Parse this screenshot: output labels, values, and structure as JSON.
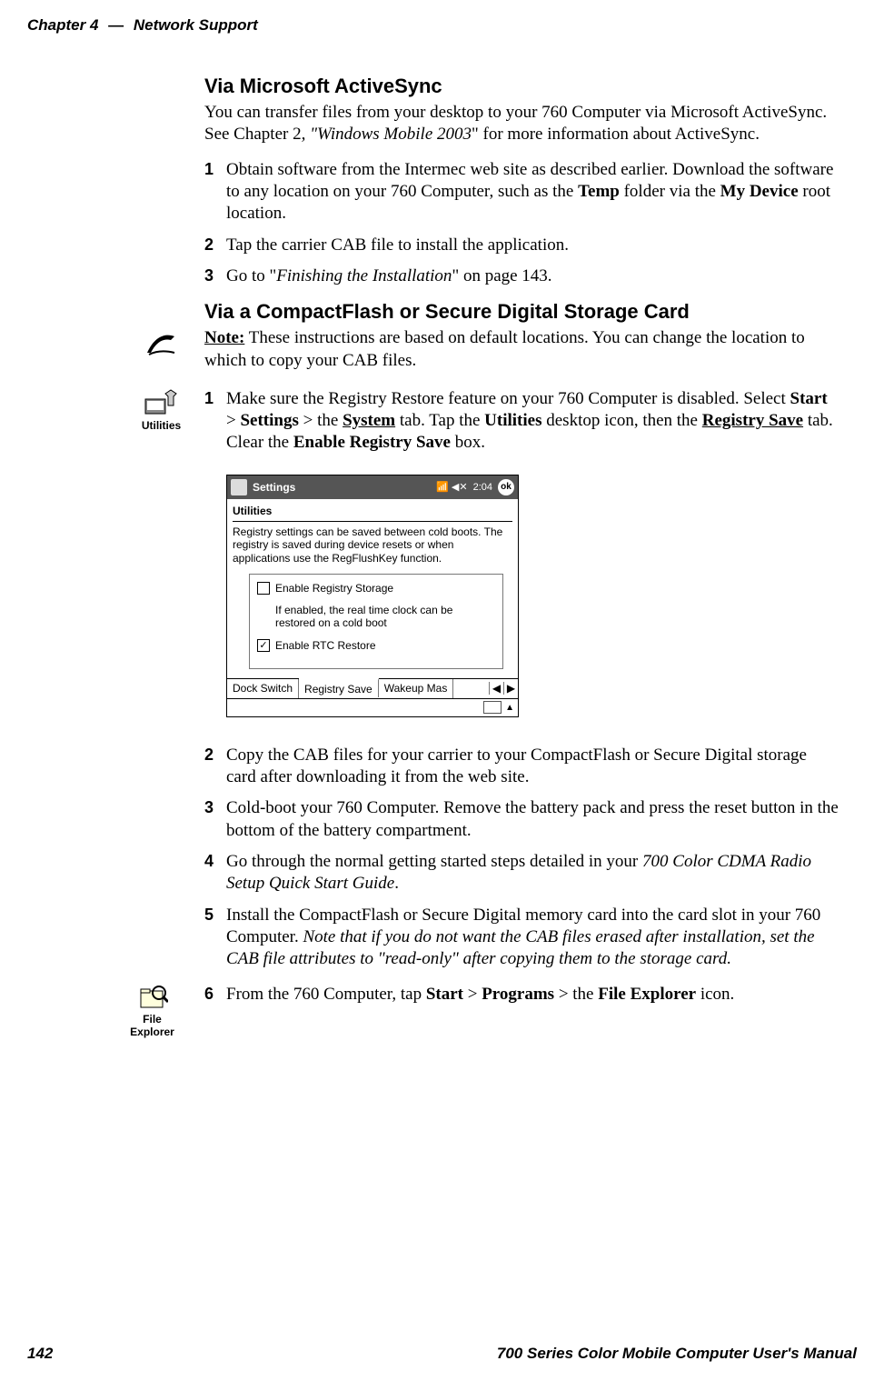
{
  "header": {
    "chapter": "Chapter 4",
    "dash": "—",
    "title": "Network Support"
  },
  "s1": {
    "heading": "Via Microsoft ActiveSync",
    "para_a": "You can transfer files from your desktop to your 760 Computer via Microsoft ActiveSync. See Chapter 2",
    "para_b": ", \"Windows Mobile 2003",
    "para_c": "\" for more information about ActiveSync.",
    "li1_a": "Obtain software from the Intermec web site as described earlier. Download the software to any location on your 760 Computer, such as the ",
    "li1_b": "Temp",
    "li1_c": " folder via the ",
    "li1_d": "My Device",
    "li1_e": " root location.",
    "li2": "Tap the carrier CAB file to install the application.",
    "li3_a": "Go to \"",
    "li3_b": "Finishing the Installation",
    "li3_c": "\" on page 143."
  },
  "s2": {
    "heading": "Via a CompactFlash or Secure Digital Storage Card",
    "note_label": "Note:",
    "note_text": " These instructions are based on default locations. You can change the location to which to copy your CAB files.",
    "util_caption": "Utilities",
    "li1_a": "Make sure the Registry Restore feature on your 760 Computer is disabled. Select ",
    "li1_b": "Start",
    "li1_c": " > ",
    "li1_d": "Settings",
    "li1_e": " > the ",
    "li1_f": "System",
    "li1_g": " tab. Tap the ",
    "li1_h": "Utilities",
    "li1_i": " desktop icon, then the ",
    "li1_j": "Registry Save",
    "li1_k": " tab. Clear the ",
    "li1_l": "Enable Registry Save",
    "li1_m": " box."
  },
  "pda": {
    "titlebar": "Settings",
    "time": "2:04",
    "ok": "ok",
    "apptitle": "Utilities",
    "desc": "Registry settings can be saved between cold boots. The registry is saved during device resets or when applications use the RegFlushKey function.",
    "chk1": "Enable Registry Storage",
    "sub": "If enabled, the real time clock can be restored on a cold boot",
    "chk2": "Enable RTC Restore",
    "tab1": "Dock Switch",
    "tab2": "Registry Save",
    "tab3": "Wakeup Mas"
  },
  "s3": {
    "li2": "Copy the CAB files for your carrier to your CompactFlash or Secure Digital storage card after downloading it from the web site.",
    "li3": "Cold-boot your 760 Computer. Remove the battery pack and press the reset button in the bottom of the battery compartment.",
    "li4_a": "Go through the normal getting started steps detailed in your ",
    "li4_b": "700 Color CDMA Radio Setup Quick Start Guide",
    "li4_c": ".",
    "li5_a": "Install the CompactFlash or Secure Digital memory card into the card slot in your 760 Computer. ",
    "li5_b": "Note that if you do not want the CAB files erased after installation, set the CAB file attributes to \"read-only\" after copying them to the storage card.",
    "li6_a": "From the 760 Computer, tap ",
    "li6_b": "Start",
    "li6_c": " > ",
    "li6_d": "Programs",
    "li6_e": " > the ",
    "li6_f": "File Explorer",
    "li6_g": " icon.",
    "fe_caption": "File Explorer"
  },
  "footer": {
    "page": "142",
    "manual": "700 Series Color Mobile Computer User's Manual"
  },
  "nums": {
    "n1": "1",
    "n2": "2",
    "n3": "3",
    "n4": "4",
    "n5": "5",
    "n6": "6"
  }
}
